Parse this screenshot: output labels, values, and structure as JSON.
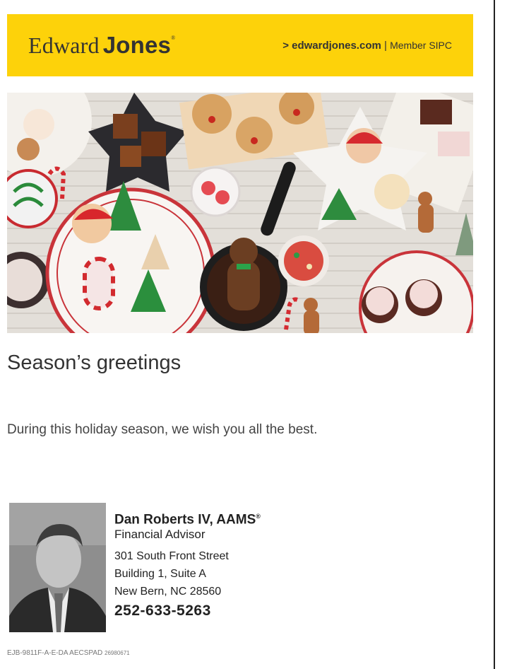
{
  "header": {
    "logo_first": "Edward",
    "logo_second": "Jones",
    "logo_mark": "®",
    "site_link": "> edwardjones.com",
    "separator": "|",
    "member": "Member SIPC",
    "background_color": "#fdd20a"
  },
  "hero": {
    "icon": "holiday-cookies-image"
  },
  "headline": "Season’s greetings",
  "message": "During this holiday season, we wish you all the best.",
  "advisor": {
    "name": "Dan Roberts IV, AAMS",
    "name_mark": "®",
    "title": "Financial Advisor",
    "address_line1": "301 South Front Street",
    "address_line2": "Building 1, Suite A",
    "address_line3": "New Bern, NC 28560",
    "phone": "252-633-5263"
  },
  "footer": {
    "code": "EJB-9811F-A-E-DA AECSPAD",
    "number": "26980671"
  }
}
